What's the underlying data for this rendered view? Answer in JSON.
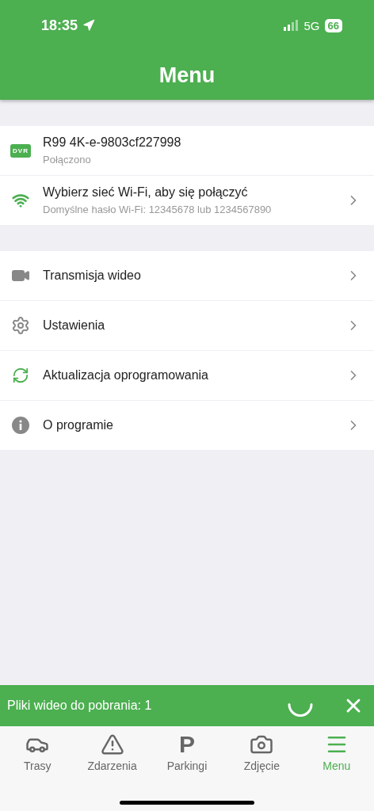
{
  "status_bar": {
    "time": "18:35",
    "network": "5G",
    "battery": "66"
  },
  "header": {
    "title": "Menu"
  },
  "device_section": [
    {
      "kind": "dvr",
      "badge": "DVR",
      "title": "R99 4K-e-9803cf227998",
      "subtitle": "Połączono",
      "chevron": false
    },
    {
      "kind": "wifi",
      "title": "Wybierz sieć Wi-Fi, aby się połączyć",
      "subtitle": "Domyślne hasło Wi-Fi: 12345678 lub 1234567890",
      "chevron": true
    }
  ],
  "menu_items": [
    {
      "kind": "video",
      "label": "Transmisja wideo"
    },
    {
      "kind": "settings",
      "label": "Ustawienia"
    },
    {
      "kind": "update",
      "label": "Aktualizacja oprogramowania"
    },
    {
      "kind": "info",
      "label": "O programie"
    }
  ],
  "download_banner": {
    "text": "Pliki wideo do pobrania: 1"
  },
  "tab_bar": [
    {
      "kind": "car",
      "label": "Trasy",
      "selected": false
    },
    {
      "kind": "warning",
      "label": "Zdarzenia",
      "selected": false
    },
    {
      "kind": "parking",
      "glyph": "P",
      "label": "Parkingi",
      "selected": false
    },
    {
      "kind": "camera",
      "label": "Zdjęcie",
      "selected": false
    },
    {
      "kind": "menu",
      "label": "Menu",
      "selected": true
    }
  ]
}
